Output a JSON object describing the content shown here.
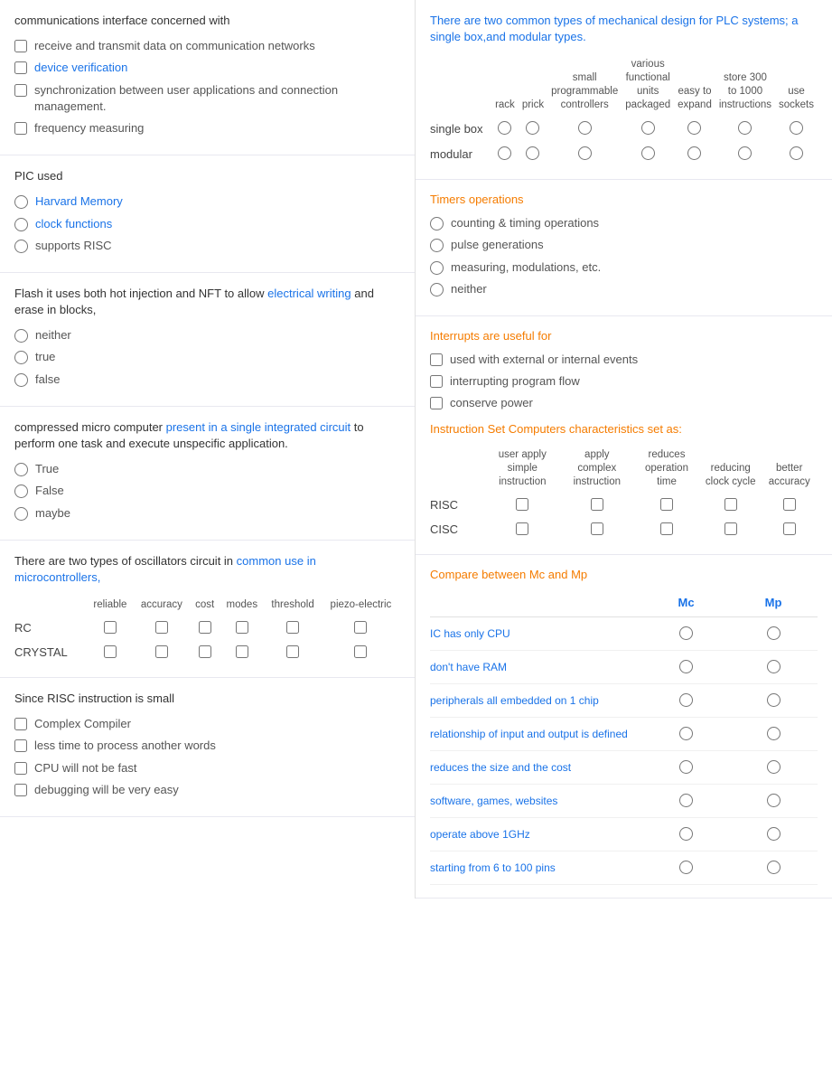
{
  "left": {
    "sections": [
      {
        "id": "comm-interface",
        "question": "communications interface concerned with",
        "options": [
          {
            "id": "opt1",
            "text": "receive and transmit data on communication networks",
            "type": "checkbox"
          },
          {
            "id": "opt2",
            "text": "device verification",
            "type": "checkbox",
            "link": true
          },
          {
            "id": "opt3",
            "text": "synchronization between user applications and connection management.",
            "type": "checkbox"
          },
          {
            "id": "opt4",
            "text": "frequency measuring",
            "type": "checkbox"
          }
        ]
      },
      {
        "id": "pic-used",
        "question": "PIC used",
        "options": [
          {
            "id": "opt1",
            "text": "Harvard Memory",
            "type": "radio",
            "link": true
          },
          {
            "id": "opt2",
            "text": "clock functions",
            "type": "radio",
            "link": true
          },
          {
            "id": "opt3",
            "text": "supports RISC",
            "type": "radio"
          }
        ]
      },
      {
        "id": "flash",
        "question_parts": [
          {
            "text": "Flash it uses both hot injection and NFT to allow ",
            "blue": false
          },
          {
            "text": "electrical writing",
            "blue": true
          },
          {
            "text": " and erase in blocks,",
            "blue": false
          }
        ],
        "options": [
          {
            "id": "opt1",
            "text": "neither",
            "type": "radio"
          },
          {
            "id": "opt2",
            "text": "true",
            "type": "radio"
          },
          {
            "id": "opt3",
            "text": "false",
            "type": "radio"
          }
        ]
      },
      {
        "id": "micro",
        "question_parts": [
          {
            "text": "compressed micro computer ",
            "blue": false
          },
          {
            "text": "present in a single integrated circuit",
            "blue": true
          },
          {
            "text": " to perform one task and execute unspecific application.",
            "blue": false
          }
        ],
        "options": [
          {
            "id": "opt1",
            "text": "True",
            "type": "radio"
          },
          {
            "id": "opt2",
            "text": "False",
            "type": "radio"
          },
          {
            "id": "opt3",
            "text": "maybe",
            "type": "radio"
          }
        ]
      },
      {
        "id": "oscillators",
        "question_parts": [
          {
            "text": "There are two types of oscillators circuit in ",
            "blue": false
          },
          {
            "text": "common use in microcontrollers,",
            "blue": true
          }
        ],
        "table": {
          "headers": [
            "",
            "reliable",
            "accuracy",
            "cost",
            "modes",
            "threshold",
            "piezo-electric"
          ],
          "rows": [
            {
              "label": "RC",
              "values": [
                false,
                false,
                false,
                false,
                false,
                false
              ]
            },
            {
              "label": "CRYSTAL",
              "values": [
                false,
                false,
                false,
                false,
                false,
                false
              ]
            }
          ]
        }
      },
      {
        "id": "risc",
        "question": "Since RISC instruction is small",
        "options": [
          {
            "id": "opt1",
            "text": "Complex Compiler",
            "type": "checkbox"
          },
          {
            "id": "opt2",
            "text": "less time to process another words",
            "type": "checkbox"
          },
          {
            "id": "opt3",
            "text": "CPU will not be fast",
            "type": "checkbox"
          },
          {
            "id": "opt4",
            "text": "debugging will be very easy",
            "type": "checkbox"
          }
        ]
      }
    ]
  },
  "right": {
    "sections": [
      {
        "id": "plc",
        "question": "There are two common types of mechanical design for PLC systems; a single box,and modular types.",
        "question_blue": "There are two common types of mechanical design for PLC systems; a single box,and modular types.",
        "table": {
          "headers": [
            "",
            "rack",
            "prick",
            "small programmable controllers",
            "various functional units packaged",
            "easy to expand",
            "store 300 to 1000 instructions",
            "use sockets"
          ],
          "rows": [
            {
              "label": "single box",
              "values": [
                false,
                false,
                false,
                false,
                false,
                false,
                false
              ]
            },
            {
              "label": "modular",
              "values": [
                false,
                false,
                false,
                false,
                false,
                false,
                false
              ]
            }
          ]
        }
      },
      {
        "id": "timers",
        "title": "Timers operations",
        "options": [
          {
            "id": "opt1",
            "text": "counting & timing operations",
            "type": "radio"
          },
          {
            "id": "opt2",
            "text": "pulse generations",
            "type": "radio"
          },
          {
            "id": "opt3",
            "text": "measuring, modulations, etc.",
            "type": "radio"
          },
          {
            "id": "opt4",
            "text": "neither",
            "type": "radio"
          }
        ]
      },
      {
        "id": "interrupts",
        "title": "Interrupts are useful for",
        "options": [
          {
            "id": "opt1",
            "text": "used with external or internal events",
            "type": "checkbox"
          },
          {
            "id": "opt2",
            "text": "interrupting program flow",
            "type": "checkbox"
          },
          {
            "id": "opt3",
            "text": "conserve power",
            "type": "checkbox"
          }
        ],
        "table_title": "Instruction Set Computers characteristics set as:",
        "table": {
          "headers": [
            "",
            "user apply simple instruction",
            "apply complex instruction",
            "reduces operation time",
            "reducing clock cycle",
            "better accuracy"
          ],
          "rows": [
            {
              "label": "RISC",
              "values": [
                false,
                false,
                false,
                false,
                false
              ]
            },
            {
              "label": "CISC",
              "values": [
                false,
                false,
                false,
                false,
                false
              ]
            }
          ]
        }
      },
      {
        "id": "compare",
        "title": "Compare between Mc and Mp",
        "col1": "Mc",
        "col2": "Mp",
        "rows": [
          {
            "label": "IC has only CPU"
          },
          {
            "label": "don't have RAM"
          },
          {
            "label": "peripherals all embedded on 1 chip"
          },
          {
            "label": "relationship of input and output is defined"
          },
          {
            "label": "reduces the size and the cost"
          },
          {
            "label": "software, games, websites"
          },
          {
            "label": "operate above 1GHz"
          },
          {
            "label": "starting from 6 to 100 pins"
          }
        ]
      }
    ]
  }
}
